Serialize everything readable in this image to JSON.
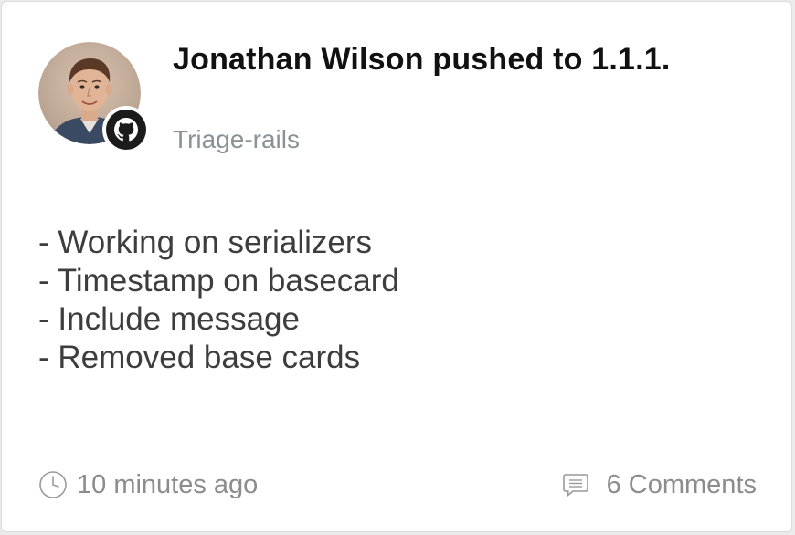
{
  "card": {
    "title": "Jonathan Wilson pushed to 1.1.1.",
    "repo": "Triage-rails",
    "commits": [
      "- Working on serializers",
      "- Timestamp on basecard",
      "- Include message",
      "- Removed base cards"
    ],
    "timestamp": "10 minutes ago",
    "comments": "6 Comments"
  },
  "icons": {
    "source": "github-icon",
    "time": "clock-icon",
    "comments": "comment-icon"
  }
}
